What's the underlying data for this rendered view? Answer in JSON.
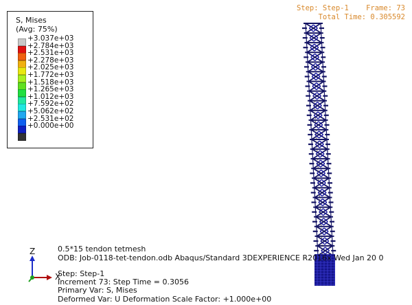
{
  "legend": {
    "title_line1": "S, Mises",
    "title_line2": "(Avg: 75%)",
    "bands": [
      {
        "label": "+3.037e+03",
        "color": "#c8c8c8"
      },
      {
        "label": "+2.784e+03",
        "color": "#e01010"
      },
      {
        "label": "+2.531e+03",
        "color": "#f06010"
      },
      {
        "label": "+2.278e+03",
        "color": "#f0b010"
      },
      {
        "label": "+2.025e+03",
        "color": "#e8e810"
      },
      {
        "label": "+1.772e+03",
        "color": "#a8f020"
      },
      {
        "label": "+1.518e+03",
        "color": "#60e020"
      },
      {
        "label": "+1.265e+03",
        "color": "#20e040"
      },
      {
        "label": "+1.012e+03",
        "color": "#20e8a0"
      },
      {
        "label": "+7.592e+02",
        "color": "#20e8e0"
      },
      {
        "label": "+5.062e+02",
        "color": "#20a8f0"
      },
      {
        "label": "+2.531e+02",
        "color": "#1060f0"
      },
      {
        "label": "+0.000e+00",
        "color": "#1020c0"
      },
      {
        "label": "",
        "color": "#333333"
      }
    ]
  },
  "frame": {
    "step_line": "Step: Step-1    Frame: 73",
    "time_line": "Total Time: 0.305592"
  },
  "triad": {
    "x": "X",
    "z": "Z"
  },
  "info": {
    "model_name": "0.5*15 tendon tetmesh",
    "odb_line": "ODB: Job-0118-tet-tendon.odb    Abaqus/Standard 3DEXPERIENCE R2016x    Wed Jan 20 0",
    "step": "Step: Step-1",
    "increment": "Increment     73: Step Time =    0.3056",
    "primary_var": "Primary Var: S, Mises",
    "deformed_var": "Deformed Var: U   Deformation Scale Factor: +1.000e+00"
  },
  "colors": {
    "mesh_dark": "#141464",
    "mesh_mid": "#1a1aa0",
    "background": "#ffffff",
    "frame_text": "#d8882a"
  }
}
